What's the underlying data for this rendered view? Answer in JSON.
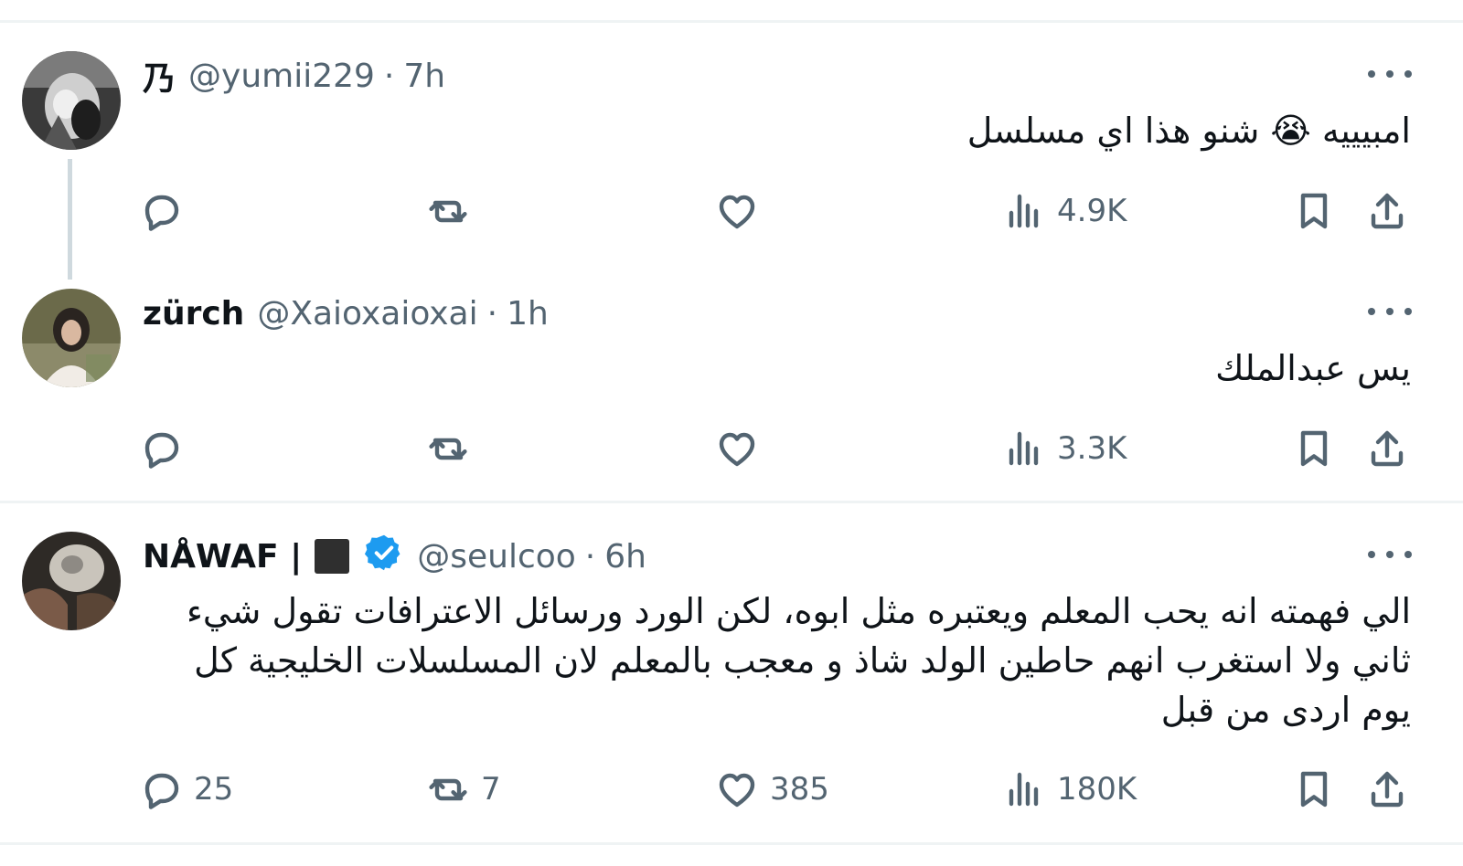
{
  "tweets": [
    {
      "display_name": "乃",
      "handle": "@yumii229",
      "dot": "·",
      "time": "7h",
      "text": "امبيييه 😭 شنو هذا اي مسلسل",
      "replies": "",
      "retweets": "",
      "likes": "",
      "views": "4.9K",
      "avatar_icon": "profile-photo"
    },
    {
      "display_name": "zürch",
      "handle": "@Xaioxaioxai",
      "dot": "·",
      "time": "1h",
      "text": "يس عبدالملك",
      "replies": "",
      "retweets": "",
      "likes": "",
      "views": "3.3K",
      "avatar_icon": "profile-photo"
    },
    {
      "display_name": "NÅWAF |",
      "handle": "@seulcoo",
      "dot": "·",
      "time": "6h",
      "text_lines": [
        "الي فهمته انه يحب المعلم ويعتبره مثل ابوه، لكن الورد ورسائل الاعترافات تقول شيء",
        "ثاني ولا استغرب انهم حاطين الولد شاذ و معجب بالمعلم لان المسلسلات الخليجية كل",
        "يوم اردى من قبل"
      ],
      "replies": "25",
      "retweets": "7",
      "likes": "385",
      "views": "180K",
      "verified": true,
      "avatar_icon": "profile-photo"
    }
  ],
  "colors": {
    "text": "#0f1419",
    "secondary": "#536471",
    "separator": "#eff3f4",
    "thread_line": "#cfd9de",
    "verified": "#1d9bf0"
  },
  "icons": [
    "reply-icon",
    "retweet-icon",
    "like-icon",
    "views-icon",
    "bookmark-icon",
    "share-icon",
    "more-icon",
    "verified-badge-icon"
  ]
}
